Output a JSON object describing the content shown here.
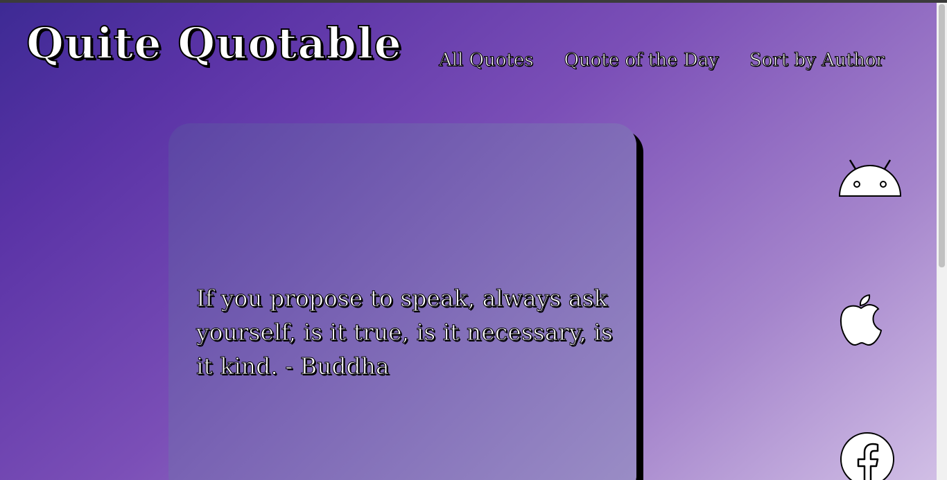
{
  "header": {
    "logo": "Quite Quotable",
    "nav": [
      {
        "label": "All Quotes"
      },
      {
        "label": "Quote of the Day"
      },
      {
        "label": "Sort by Author"
      }
    ]
  },
  "quote_card": {
    "text": "If you propose to speak, always ask yourself, is it true, is it necessary, is it kind. - Buddha"
  },
  "social_icons": [
    "android-icon",
    "apple-icon",
    "facebook-icon"
  ],
  "colors": {
    "background_start": "#3d2a94",
    "background_end": "#d2c0e6",
    "card": "#7a64b4",
    "text": "#ffffff",
    "outline": "#000000"
  }
}
